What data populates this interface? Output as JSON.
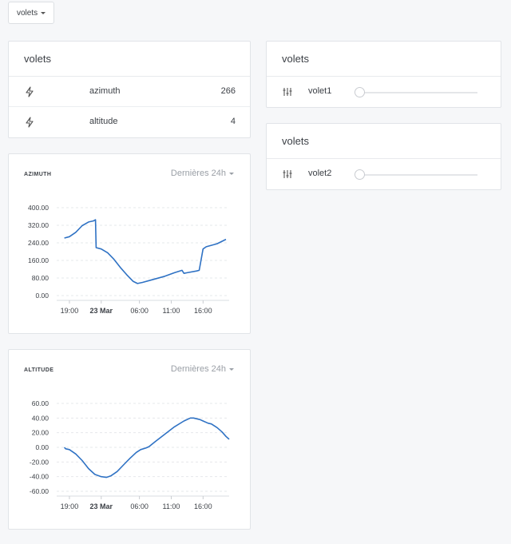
{
  "topbar": {
    "dropdown_label": "volets"
  },
  "sensors_card": {
    "title": "volets",
    "rows": [
      {
        "icon": "bolt-icon",
        "label": "azimuth",
        "value": "266"
      },
      {
        "icon": "bolt-icon",
        "label": "altitude",
        "value": "4"
      }
    ]
  },
  "volet1_card": {
    "title": "volets",
    "label": "volet1",
    "slider_value": 0
  },
  "volet2_card": {
    "title": "volets",
    "label": "volet2",
    "slider_value": 0
  },
  "azimuth_chart": {
    "title": "AZIMUTH",
    "range": "Dernières 24h",
    "chart_data": {
      "type": "line",
      "title": "AZIMUTH",
      "x_ticks": [
        "19:00",
        "23 Mar",
        "06:00",
        "11:00",
        "16:00"
      ],
      "y_ticks": [
        "400.00",
        "320.00",
        "240.00",
        "160.00",
        "80.00",
        "0.00"
      ],
      "ylim": [
        0,
        400
      ],
      "x_unit": "hours since 18:00",
      "series": [
        {
          "points": [
            [
              0.2,
              262
            ],
            [
              1,
              268
            ],
            [
              2,
              288
            ],
            [
              3,
              318
            ],
            [
              4,
              335
            ],
            [
              4.8,
              340
            ],
            [
              5.1,
              345
            ],
            [
              5.2,
              218
            ],
            [
              6,
              212
            ],
            [
              7,
              195
            ],
            [
              8,
              165
            ],
            [
              9,
              128
            ],
            [
              10,
              95
            ],
            [
              11,
              65
            ],
            [
              11.7,
              55
            ],
            [
              12.5,
              60
            ],
            [
              14,
              72
            ],
            [
              16,
              88
            ],
            [
              17.5,
              104
            ],
            [
              18.7,
              115
            ],
            [
              19,
              101
            ],
            [
              19.5,
              104
            ],
            [
              21,
              112
            ],
            [
              21.4,
              115
            ],
            [
              22,
              212
            ],
            [
              22.5,
              222
            ],
            [
              24.2,
              236
            ],
            [
              25.6,
              256
            ]
          ]
        }
      ]
    }
  },
  "altitude_chart": {
    "title": "ALTITUDE",
    "range": "Dernières 24h",
    "chart_data": {
      "type": "line",
      "title": "ALTITUDE",
      "x_ticks": [
        "19:00",
        "23 Mar",
        "06:00",
        "11:00",
        "16:00"
      ],
      "y_ticks": [
        "60.00",
        "40.00",
        "20.00",
        "0.00",
        "-20.00",
        "-40.00",
        "-60.00"
      ],
      "ylim": [
        -60,
        60
      ],
      "series": [
        {
          "points": [
            [
              0.2,
              0
            ],
            [
              0.4,
              -2
            ],
            [
              1,
              -3
            ],
            [
              2,
              -9
            ],
            [
              3,
              -18
            ],
            [
              4,
              -29
            ],
            [
              5,
              -37
            ],
            [
              6,
              -40
            ],
            [
              6.8,
              -41
            ],
            [
              7.5,
              -39
            ],
            [
              8.5,
              -33
            ],
            [
              9.5,
              -24
            ],
            [
              10.5,
              -15
            ],
            [
              11.5,
              -7
            ],
            [
              12.2,
              -3
            ],
            [
              13,
              -1
            ],
            [
              13.5,
              1
            ],
            [
              14.5,
              8
            ],
            [
              16,
              18
            ],
            [
              17.5,
              28
            ],
            [
              19,
              36
            ],
            [
              20,
              40
            ],
            [
              20.5,
              40
            ],
            [
              21.5,
              38
            ],
            [
              22,
              36
            ],
            [
              22.8,
              33
            ],
            [
              23.3,
              32
            ],
            [
              24.2,
              27
            ],
            [
              25,
              21
            ],
            [
              25.6,
              15
            ],
            [
              26.1,
              11
            ]
          ]
        }
      ]
    }
  }
}
